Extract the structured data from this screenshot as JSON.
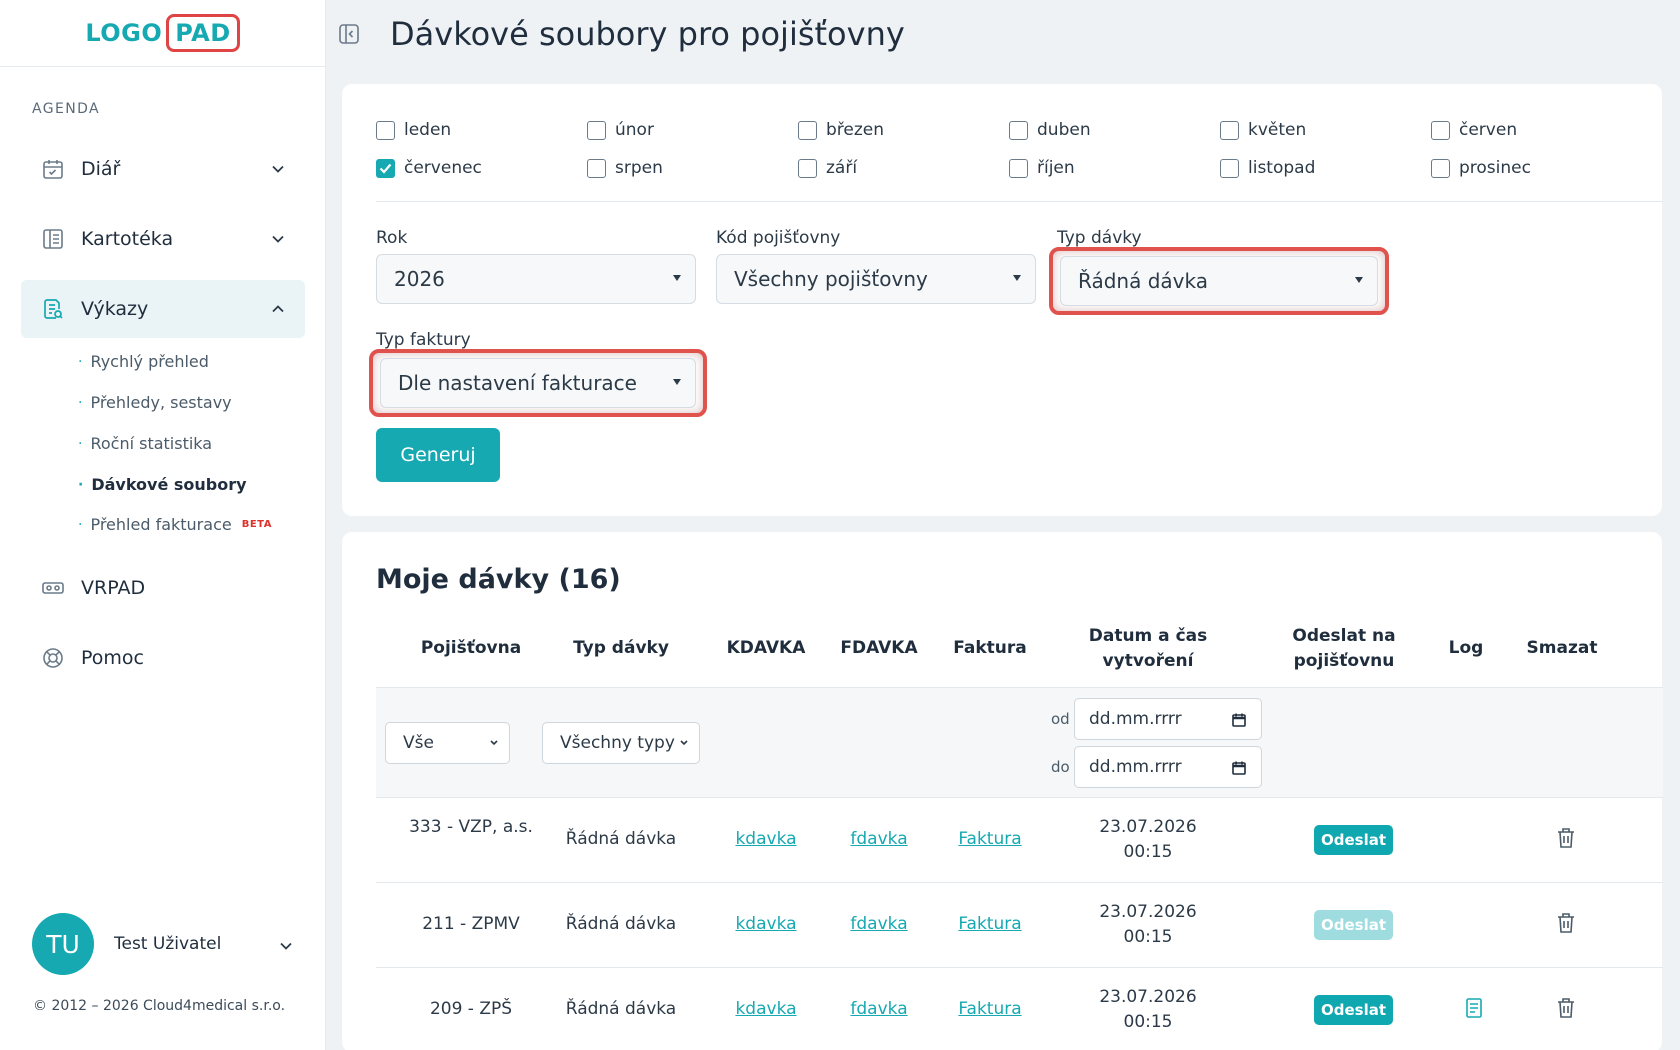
{
  "logo": {
    "part1": "LOGO",
    "part2": "PAD"
  },
  "sidebar": {
    "section": "AGENDA",
    "items": [
      {
        "label": "Diář",
        "icon": "calendar-icon"
      },
      {
        "label": "Kartotéka",
        "icon": "card-index-icon"
      },
      {
        "label": "Výkazy",
        "icon": "report-icon"
      },
      {
        "label": "VRPAD",
        "icon": "vr-headset-icon"
      },
      {
        "label": "Pomoc",
        "icon": "lifebuoy-icon"
      }
    ],
    "subitems": [
      "Rychlý přehled",
      "Přehledy, sestavy",
      "Roční statistika",
      "Dávkové soubory",
      "Přehled fakturace"
    ],
    "beta": "BETA",
    "user": {
      "initials": "TU",
      "name": "Test Uživatel"
    },
    "copyright": "© 2012 – 2026 Cloud4medical s.r.o."
  },
  "header": {
    "title": "Dávkové soubory pro pojišťovny"
  },
  "filters": {
    "months": [
      {
        "label": "leden",
        "checked": false
      },
      {
        "label": "únor",
        "checked": false
      },
      {
        "label": "březen",
        "checked": false
      },
      {
        "label": "duben",
        "checked": false
      },
      {
        "label": "květen",
        "checked": false
      },
      {
        "label": "červen",
        "checked": false
      },
      {
        "label": "červenec",
        "checked": true
      },
      {
        "label": "srpen",
        "checked": false
      },
      {
        "label": "září",
        "checked": false
      },
      {
        "label": "říjen",
        "checked": false
      },
      {
        "label": "listopad",
        "checked": false
      },
      {
        "label": "prosinec",
        "checked": false
      }
    ],
    "year_label": "Rok",
    "year_value": "2026",
    "insurer_label": "Kód pojišťovny",
    "insurer_value": "Všechny pojišťovny",
    "batch_type_label": "Typ dávky",
    "batch_type_value": "Řádná dávka",
    "invoice_type_label": "Typ faktury",
    "invoice_type_value": "Dle nastavení fakturace",
    "generate_label": "Generuj"
  },
  "batches": {
    "title": "Moje dávky (16)",
    "columns": [
      "Pojišťovna",
      "Typ dávky",
      "KDAVKA",
      "FDAVKA",
      "Faktura",
      "Datum a čas vytvoření",
      "Odeslat na pojišťovnu",
      "Log",
      "Smazat"
    ],
    "filter_insurer": "Vše",
    "filter_type": "Všechny typy",
    "date_from_label": "od",
    "date_to_label": "do",
    "date_placeholder": "dd.mm.rrrr",
    "rows": [
      {
        "insurer": "333 - VZP, a.s.",
        "type": "Řádná dávka",
        "kdavka": "kdavka",
        "fdavka": "fdavka",
        "invoice": "Faktura",
        "datetime": "23.07.2026 00:15",
        "send": "Odeslat",
        "send_enabled": true,
        "has_log": false
      },
      {
        "insurer": "211 - ZPMV",
        "type": "Řádná dávka",
        "kdavka": "kdavka",
        "fdavka": "fdavka",
        "invoice": "Faktura",
        "datetime": "23.07.2026 00:15",
        "send": "Odeslat",
        "send_enabled": false,
        "has_log": false
      },
      {
        "insurer": "209 - ZPŠ",
        "type": "Řádná dávka",
        "kdavka": "kdavka",
        "fdavka": "fdavka",
        "invoice": "Faktura",
        "datetime": "23.07.2026 00:15",
        "send": "Odeslat",
        "send_enabled": true,
        "has_log": true
      }
    ]
  },
  "colors": {
    "accent": "#16a9b2",
    "highlight": "#e0534d"
  }
}
